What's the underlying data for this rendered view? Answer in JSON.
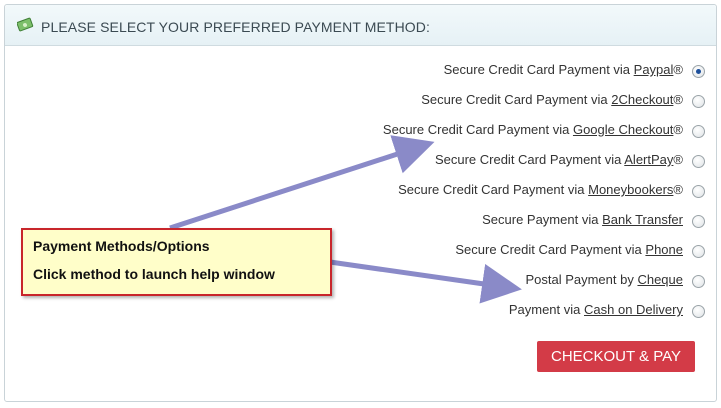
{
  "header": {
    "title": "PLEASE SELECT YOUR PREFERRED PAYMENT METHOD:",
    "icon": "money-icon"
  },
  "payment_options": [
    {
      "prefix": "Secure Credit Card Payment via ",
      "link": "Paypal",
      "suffix": "®",
      "selected": true
    },
    {
      "prefix": "Secure Credit Card Payment via ",
      "link": "2Checkout",
      "suffix": "®",
      "selected": false
    },
    {
      "prefix": "Secure Credit Card Payment via ",
      "link": "Google Checkout",
      "suffix": "®",
      "selected": false
    },
    {
      "prefix": "Secure Credit Card Payment via ",
      "link": "AlertPay",
      "suffix": "®",
      "selected": false
    },
    {
      "prefix": "Secure Credit Card Payment via ",
      "link": "Moneybookers",
      "suffix": "®",
      "selected": false
    },
    {
      "prefix": "Secure Payment via ",
      "link": "Bank Transfer",
      "suffix": "",
      "selected": false
    },
    {
      "prefix": "Secure Credit Card Payment via ",
      "link": "Phone",
      "suffix": "",
      "selected": false
    },
    {
      "prefix": "Postal Payment by ",
      "link": "Cheque",
      "suffix": "",
      "selected": false
    },
    {
      "prefix": "Payment via ",
      "link": "Cash on Delivery",
      "suffix": "",
      "selected": false
    }
  ],
  "checkout": {
    "label": "CHECKOUT & PAY"
  },
  "callout": {
    "line1": "Payment Methods/Options",
    "line2": "Click method to launch help window"
  },
  "colors": {
    "checkout_bg": "#d33b47",
    "callout_bg": "#fffec9",
    "callout_border": "#c8262b",
    "arrow": "#8a8ac8"
  }
}
